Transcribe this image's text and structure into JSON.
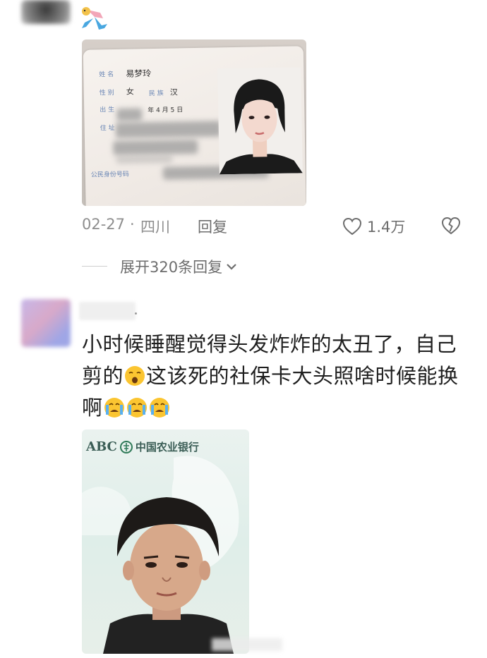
{
  "comments": [
    {
      "id_card": {
        "name_label": "姓 名",
        "name_value": "易梦玲",
        "gender_label": "性 别",
        "gender_value": "女",
        "ethnicity_label": "民 族",
        "ethnicity_value": "汉",
        "birth_label": "出 生",
        "birth_value": "年 4 月 5 日",
        "address_label": "住 址",
        "id_number_label": "公民身份号码"
      },
      "date": "02-27",
      "separator": "·",
      "location": "四川",
      "reply_label": "回复",
      "likes": "1.4万",
      "expand_replies_label": "展开320条回复"
    },
    {
      "text_parts": [
        "小时候睡醒觉得头发炸炸的太丑了，自己剪的",
        "这该死的社保卡大头照啥时候能换啊"
      ],
      "emojis": [
        "yawning-face",
        "crying-face",
        "crying-face",
        "crying-face"
      ],
      "card": {
        "bank_abbr": "ABC",
        "bank_name": "中国农业银行"
      }
    }
  ]
}
